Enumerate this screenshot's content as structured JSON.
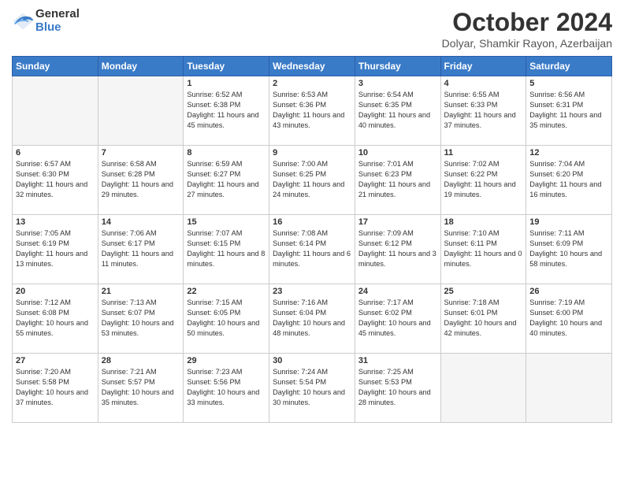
{
  "logo": {
    "general": "General",
    "blue": "Blue"
  },
  "title": "October 2024",
  "location": "Dolyar, Shamkir Rayon, Azerbaijan",
  "headers": [
    "Sunday",
    "Monday",
    "Tuesday",
    "Wednesday",
    "Thursday",
    "Friday",
    "Saturday"
  ],
  "weeks": [
    [
      {
        "day": "",
        "info": ""
      },
      {
        "day": "",
        "info": ""
      },
      {
        "day": "1",
        "info": "Sunrise: 6:52 AM\nSunset: 6:38 PM\nDaylight: 11 hours and 45 minutes."
      },
      {
        "day": "2",
        "info": "Sunrise: 6:53 AM\nSunset: 6:36 PM\nDaylight: 11 hours and 43 minutes."
      },
      {
        "day": "3",
        "info": "Sunrise: 6:54 AM\nSunset: 6:35 PM\nDaylight: 11 hours and 40 minutes."
      },
      {
        "day": "4",
        "info": "Sunrise: 6:55 AM\nSunset: 6:33 PM\nDaylight: 11 hours and 37 minutes."
      },
      {
        "day": "5",
        "info": "Sunrise: 6:56 AM\nSunset: 6:31 PM\nDaylight: 11 hours and 35 minutes."
      }
    ],
    [
      {
        "day": "6",
        "info": "Sunrise: 6:57 AM\nSunset: 6:30 PM\nDaylight: 11 hours and 32 minutes."
      },
      {
        "day": "7",
        "info": "Sunrise: 6:58 AM\nSunset: 6:28 PM\nDaylight: 11 hours and 29 minutes."
      },
      {
        "day": "8",
        "info": "Sunrise: 6:59 AM\nSunset: 6:27 PM\nDaylight: 11 hours and 27 minutes."
      },
      {
        "day": "9",
        "info": "Sunrise: 7:00 AM\nSunset: 6:25 PM\nDaylight: 11 hours and 24 minutes."
      },
      {
        "day": "10",
        "info": "Sunrise: 7:01 AM\nSunset: 6:23 PM\nDaylight: 11 hours and 21 minutes."
      },
      {
        "day": "11",
        "info": "Sunrise: 7:02 AM\nSunset: 6:22 PM\nDaylight: 11 hours and 19 minutes."
      },
      {
        "day": "12",
        "info": "Sunrise: 7:04 AM\nSunset: 6:20 PM\nDaylight: 11 hours and 16 minutes."
      }
    ],
    [
      {
        "day": "13",
        "info": "Sunrise: 7:05 AM\nSunset: 6:19 PM\nDaylight: 11 hours and 13 minutes."
      },
      {
        "day": "14",
        "info": "Sunrise: 7:06 AM\nSunset: 6:17 PM\nDaylight: 11 hours and 11 minutes."
      },
      {
        "day": "15",
        "info": "Sunrise: 7:07 AM\nSunset: 6:15 PM\nDaylight: 11 hours and 8 minutes."
      },
      {
        "day": "16",
        "info": "Sunrise: 7:08 AM\nSunset: 6:14 PM\nDaylight: 11 hours and 6 minutes."
      },
      {
        "day": "17",
        "info": "Sunrise: 7:09 AM\nSunset: 6:12 PM\nDaylight: 11 hours and 3 minutes."
      },
      {
        "day": "18",
        "info": "Sunrise: 7:10 AM\nSunset: 6:11 PM\nDaylight: 11 hours and 0 minutes."
      },
      {
        "day": "19",
        "info": "Sunrise: 7:11 AM\nSunset: 6:09 PM\nDaylight: 10 hours and 58 minutes."
      }
    ],
    [
      {
        "day": "20",
        "info": "Sunrise: 7:12 AM\nSunset: 6:08 PM\nDaylight: 10 hours and 55 minutes."
      },
      {
        "day": "21",
        "info": "Sunrise: 7:13 AM\nSunset: 6:07 PM\nDaylight: 10 hours and 53 minutes."
      },
      {
        "day": "22",
        "info": "Sunrise: 7:15 AM\nSunset: 6:05 PM\nDaylight: 10 hours and 50 minutes."
      },
      {
        "day": "23",
        "info": "Sunrise: 7:16 AM\nSunset: 6:04 PM\nDaylight: 10 hours and 48 minutes."
      },
      {
        "day": "24",
        "info": "Sunrise: 7:17 AM\nSunset: 6:02 PM\nDaylight: 10 hours and 45 minutes."
      },
      {
        "day": "25",
        "info": "Sunrise: 7:18 AM\nSunset: 6:01 PM\nDaylight: 10 hours and 42 minutes."
      },
      {
        "day": "26",
        "info": "Sunrise: 7:19 AM\nSunset: 6:00 PM\nDaylight: 10 hours and 40 minutes."
      }
    ],
    [
      {
        "day": "27",
        "info": "Sunrise: 7:20 AM\nSunset: 5:58 PM\nDaylight: 10 hours and 37 minutes."
      },
      {
        "day": "28",
        "info": "Sunrise: 7:21 AM\nSunset: 5:57 PM\nDaylight: 10 hours and 35 minutes."
      },
      {
        "day": "29",
        "info": "Sunrise: 7:23 AM\nSunset: 5:56 PM\nDaylight: 10 hours and 33 minutes."
      },
      {
        "day": "30",
        "info": "Sunrise: 7:24 AM\nSunset: 5:54 PM\nDaylight: 10 hours and 30 minutes."
      },
      {
        "day": "31",
        "info": "Sunrise: 7:25 AM\nSunset: 5:53 PM\nDaylight: 10 hours and 28 minutes."
      },
      {
        "day": "",
        "info": ""
      },
      {
        "day": "",
        "info": ""
      }
    ]
  ]
}
